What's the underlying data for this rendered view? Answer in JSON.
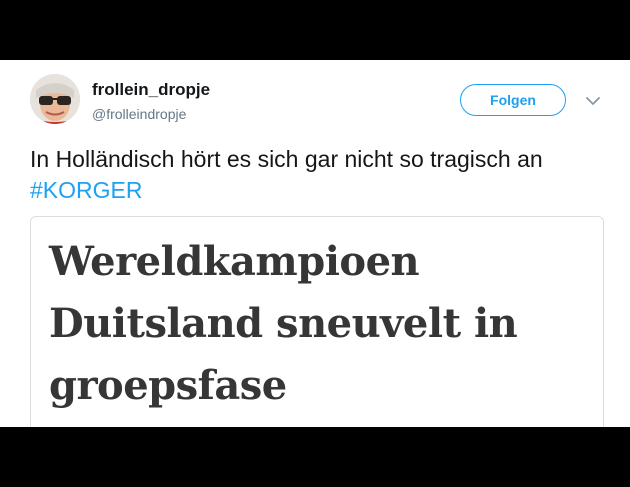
{
  "tweet": {
    "author": {
      "display_name": "frollein_dropje",
      "handle": "@frolleindropje"
    },
    "follow_label": "Folgen",
    "text_prefix": "In Holländisch hört es sich gar nicht so tragisch an ",
    "hashtag": "#KORGER",
    "media_card": {
      "headline": "Wereldkampioen Duitsland sneuvelt in groepsfase"
    }
  },
  "colors": {
    "accent": "#1da1f2",
    "text": "#14171a",
    "muted": "#657786",
    "letterbox": "#000000"
  },
  "icons": [
    "avatar",
    "chevron-down-icon"
  ]
}
